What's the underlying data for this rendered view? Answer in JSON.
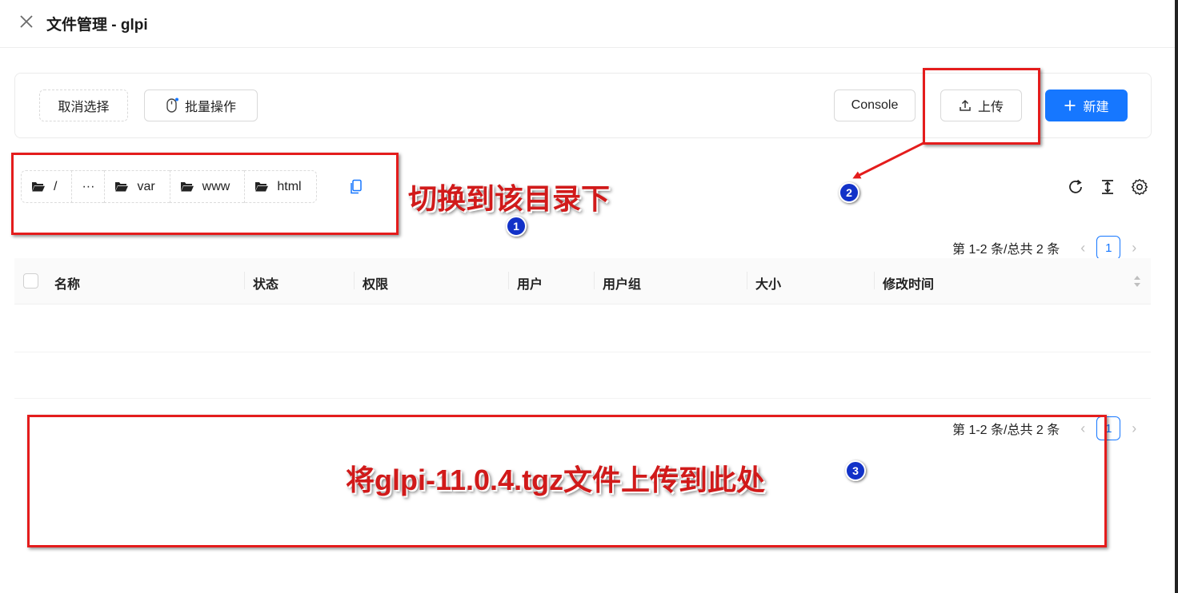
{
  "header": {
    "title": "文件管理 - glpi"
  },
  "toolbar": {
    "cancel_select": "取消选择",
    "batch_ops": "批量操作",
    "console": "Console",
    "upload": "上传",
    "new": "新建"
  },
  "breadcrumb": [
    "/",
    "···",
    "var",
    "www",
    "html"
  ],
  "pagination": {
    "total": "第 1-2 条/总共 2 条",
    "page": "1"
  },
  "table": {
    "columns": [
      "名称",
      "状态",
      "权限",
      "用户",
      "用户组",
      "大小",
      "修改时间"
    ]
  },
  "annotations": {
    "step1": "切换到该目录下",
    "step3": "将glpi-11.0.4.tgz文件上传到此处",
    "badge1": "1",
    "badge2": "2",
    "badge3": "3"
  },
  "colors": {
    "primary": "#1677ff",
    "annotation": "#e41c1c",
    "badge": "#1232c8"
  },
  "icons": [
    "close-icon",
    "mouse-icon",
    "upload-icon",
    "plus-icon",
    "folder-icon",
    "copy-icon",
    "refresh-icon",
    "column-height-icon",
    "settings-icon",
    "sort-icon"
  ]
}
